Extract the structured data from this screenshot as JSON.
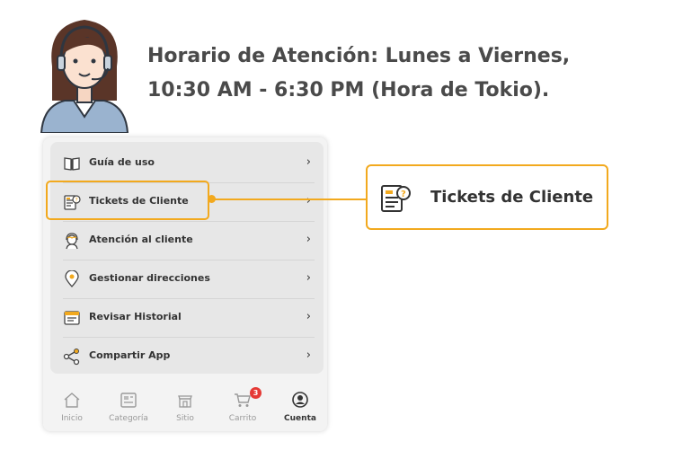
{
  "header": {
    "line1": "Horario de Atención: Lunes a Viernes,",
    "line2": "10:30 AM - 6:30 PM (Hora de Tokio)."
  },
  "menu": {
    "items": [
      {
        "label": "Guía de uso",
        "icon": "book-icon"
      },
      {
        "label": "Tickets de Cliente",
        "icon": "ticket-icon"
      },
      {
        "label": "Atención al cliente",
        "icon": "support-agent-icon"
      },
      {
        "label": "Gestionar direcciones",
        "icon": "location-pin-icon"
      },
      {
        "label": "Revisar Historial",
        "icon": "history-icon"
      },
      {
        "label": "Compartir App",
        "icon": "share-icon"
      }
    ],
    "chevron": "›"
  },
  "callout": {
    "label": "Tickets de Cliente",
    "icon": "ticket-icon"
  },
  "tabbar": {
    "tabs": [
      {
        "label": "Inicio",
        "icon": "home-icon"
      },
      {
        "label": "Categoría",
        "icon": "category-icon"
      },
      {
        "label": "Sitio",
        "icon": "store-icon"
      },
      {
        "label": "Carrito",
        "icon": "cart-icon",
        "badge": "3"
      },
      {
        "label": "Cuenta",
        "icon": "account-icon",
        "active": true
      }
    ]
  },
  "colors": {
    "accent": "#f2a91e",
    "badge": "#e53935"
  }
}
